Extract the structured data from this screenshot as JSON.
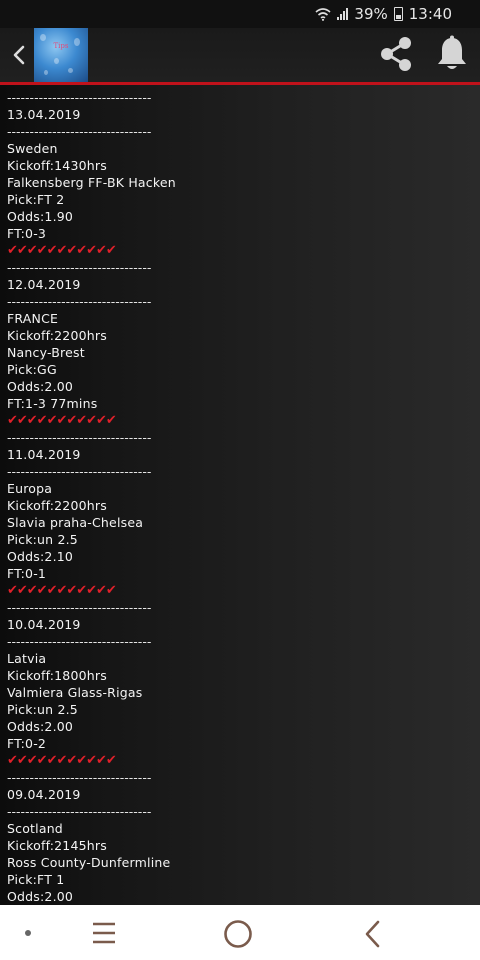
{
  "status_bar": {
    "battery": "39%",
    "time": "13:40"
  },
  "app_bar": {
    "logo_text": "Tips"
  },
  "feed": [
    {
      "type": "dash",
      "text": "--------------------------------"
    },
    {
      "type": "text",
      "text": "13.04.2019"
    },
    {
      "type": "dash",
      "text": "--------------------------------"
    },
    {
      "type": "text",
      "text": "Sweden"
    },
    {
      "type": "text",
      "text": "Kickoff:1430hrs"
    },
    {
      "type": "text",
      "text": "Falkensberg FF-BK Hacken"
    },
    {
      "type": "text",
      "text": "Pick:FT 2"
    },
    {
      "type": "text",
      "text": "Odds:1.90"
    },
    {
      "type": "text",
      "text": "FT:0-3"
    },
    {
      "type": "ticks",
      "text": "✔✔✔✔✔✔✔✔✔✔✔"
    },
    {
      "type": "dash",
      "text": "--------------------------------"
    },
    {
      "type": "text",
      "text": "12.04.2019"
    },
    {
      "type": "dash",
      "text": "--------------------------------"
    },
    {
      "type": "text",
      "text": "FRANCE"
    },
    {
      "type": "text",
      "text": "Kickoff:2200hrs"
    },
    {
      "type": "text",
      "text": "Nancy-Brest"
    },
    {
      "type": "text",
      "text": "Pick:GG"
    },
    {
      "type": "text",
      "text": "Odds:2.00"
    },
    {
      "type": "text",
      "text": "FT:1-3 77mins"
    },
    {
      "type": "ticks",
      "text": "✔✔✔✔✔✔✔✔✔✔✔"
    },
    {
      "type": "dash",
      "text": "--------------------------------"
    },
    {
      "type": "text",
      "text": "11.04.2019"
    },
    {
      "type": "dash",
      "text": "--------------------------------"
    },
    {
      "type": "text",
      "text": "Europa"
    },
    {
      "type": "text",
      "text": "Kickoff:2200hrs"
    },
    {
      "type": "text",
      "text": "Slavia praha-Chelsea"
    },
    {
      "type": "text",
      "text": "Pick:un 2.5"
    },
    {
      "type": "text",
      "text": "Odds:2.10"
    },
    {
      "type": "text",
      "text": "FT:0-1"
    },
    {
      "type": "ticks",
      "text": "✔✔✔✔✔✔✔✔✔✔✔"
    },
    {
      "type": "dash",
      "text": "--------------------------------"
    },
    {
      "type": "text",
      "text": "10.04.2019"
    },
    {
      "type": "dash",
      "text": "--------------------------------"
    },
    {
      "type": "text",
      "text": "Latvia"
    },
    {
      "type": "text",
      "text": "Kickoff:1800hrs"
    },
    {
      "type": "text",
      "text": "Valmiera Glass-Rigas"
    },
    {
      "type": "text",
      "text": "Pick:un 2.5"
    },
    {
      "type": "text",
      "text": "Odds:2.00"
    },
    {
      "type": "text",
      "text": "FT:0-2"
    },
    {
      "type": "ticks",
      "text": "✔✔✔✔✔✔✔✔✔✔✔"
    },
    {
      "type": "dash",
      "text": "--------------------------------"
    },
    {
      "type": "text",
      "text": "09.04.2019"
    },
    {
      "type": "dash",
      "text": "--------------------------------"
    },
    {
      "type": "text",
      "text": "Scotland"
    },
    {
      "type": "text",
      "text": "Kickoff:2145hrs"
    },
    {
      "type": "text",
      "text": "Ross County-Dunfermline"
    },
    {
      "type": "text",
      "text": "Pick:FT 1"
    },
    {
      "type": "text",
      "text": "Odds:2.00"
    }
  ]
}
